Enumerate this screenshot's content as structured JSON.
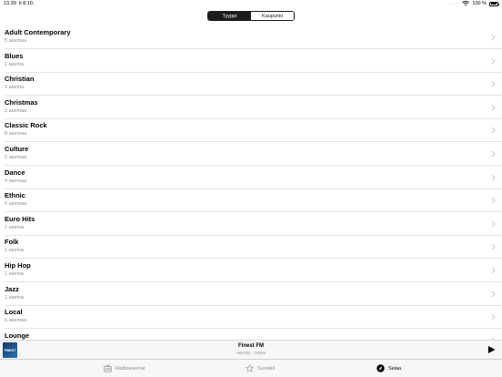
{
  "status_bar": {
    "time": "13.39",
    "date": "ti 8.10.",
    "battery": "100 %"
  },
  "segmented": {
    "options": [
      "Tyyppi",
      "Kaupunki"
    ],
    "selected": "Tyyppi"
  },
  "genres": [
    {
      "name": "Adult Contemporary",
      "count": "5 asemaa"
    },
    {
      "name": "Blues",
      "count": "1 asema"
    },
    {
      "name": "Christian",
      "count": "1 asema"
    },
    {
      "name": "Christmas",
      "count": "2 asemaa"
    },
    {
      "name": "Classic Rock",
      "count": "8 asemaa"
    },
    {
      "name": "Culture",
      "count": "2 asemaa"
    },
    {
      "name": "Dance",
      "count": "4 asemaa"
    },
    {
      "name": "Ethnic",
      "count": "6 asemaa"
    },
    {
      "name": "Euro Hits",
      "count": "1 asema"
    },
    {
      "name": "Folk",
      "count": "1 asema"
    },
    {
      "name": "Hip Hop",
      "count": "1 asema"
    },
    {
      "name": "Jazz",
      "count": "1 asema"
    },
    {
      "name": "Local",
      "count": "5 asemaa"
    },
    {
      "name": "Lounge",
      "count": ""
    }
  ],
  "now_playing": {
    "station": "Finest FM",
    "subtitle": "Helsinki · Online",
    "art_label": "FINEST"
  },
  "tabs": [
    {
      "label": "Radioasemat",
      "icon": "radio-icon",
      "active": false
    },
    {
      "label": "Suosikit",
      "icon": "star-icon",
      "active": false
    },
    {
      "label": "Selaa",
      "icon": "compass-icon",
      "active": true
    }
  ]
}
